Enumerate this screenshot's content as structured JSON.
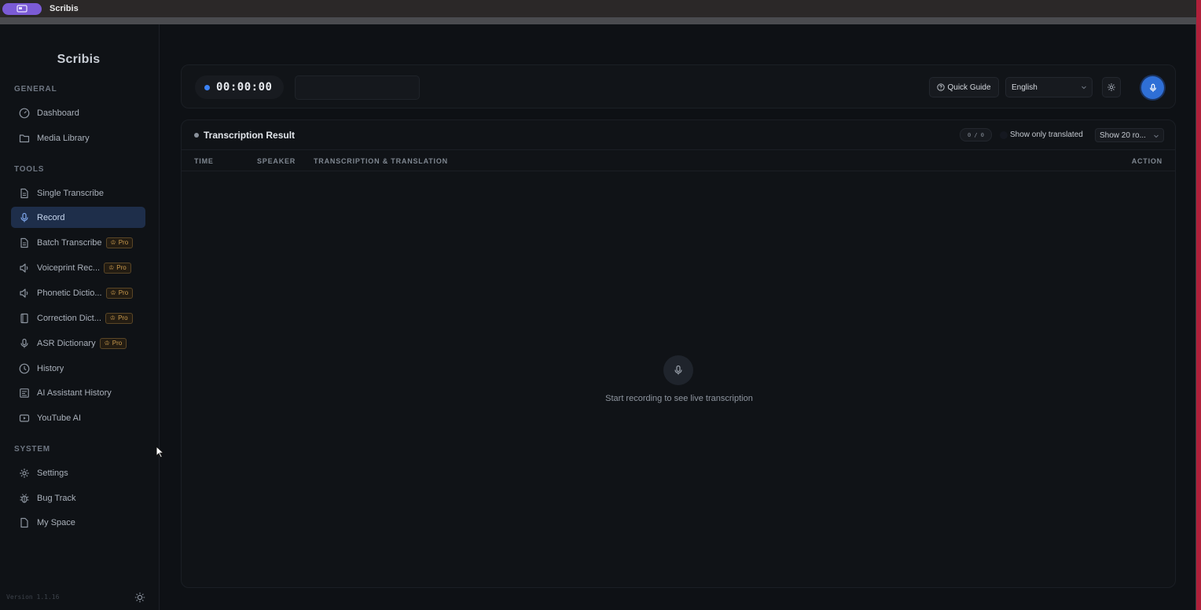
{
  "os": {
    "app_title": "Scribis"
  },
  "sidebar": {
    "brand": "Scribis",
    "sections": {
      "general": "GENERAL",
      "tools": "TOOLS",
      "system": "SYSTEM"
    },
    "items": {
      "dashboard": "Dashboard",
      "media_library": "Media Library",
      "single_transcribe": "Single Transcribe",
      "record": "Record",
      "batch_transcribe": "Batch Transcribe",
      "voiceprint": "Voiceprint Rec...",
      "phonetic": "Phonetic Dictio...",
      "correction": "Correction Dict...",
      "asr_dictionary": "ASR Dictionary",
      "history": "History",
      "ai_history": "AI Assistant History",
      "youtube_ai": "YouTube AI",
      "settings": "Settings",
      "bug_track": "Bug Track",
      "my_space": "My Space"
    },
    "pro_label": "Pro",
    "version": "Version 1.1.16",
    "active_item": "record"
  },
  "controls": {
    "timer": "00:00:00",
    "quick_guide": "Quick Guide",
    "language": "English"
  },
  "panel": {
    "title": "Transcription Result",
    "counter": "0 / 0",
    "show_translated": "Show only translated",
    "rows_select": "Show 20 ro...",
    "columns": {
      "time": "TIME",
      "speaker": "SPEAKER",
      "text": "TRANSCRIPTION & TRANSLATION",
      "action": "ACTION"
    },
    "empty_message": "Start recording to see live transcription"
  },
  "colors": {
    "accent": "#3b82f6",
    "active_nav_bg": "#1e2e4a",
    "pro_badge": "#c99a4e",
    "frame": "#b0203a"
  }
}
